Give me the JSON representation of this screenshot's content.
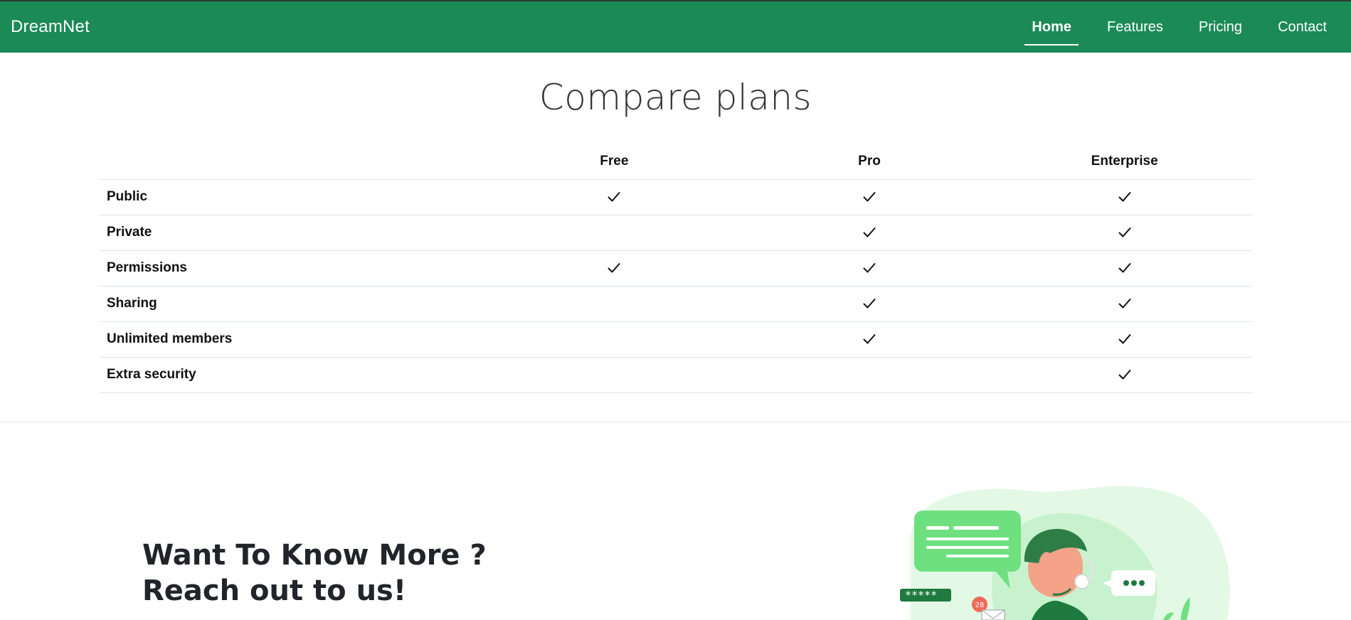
{
  "nav": {
    "brand": "DreamNet",
    "links": [
      {
        "label": "Home",
        "active": true
      },
      {
        "label": "Features",
        "active": false
      },
      {
        "label": "Pricing",
        "active": false
      },
      {
        "label": "Contact",
        "active": false
      }
    ]
  },
  "compare": {
    "title": "Compare plans",
    "plans": [
      "Free",
      "Pro",
      "Enterprise"
    ],
    "rows": [
      {
        "feature": "Public",
        "free": true,
        "pro": true,
        "enterprise": true
      },
      {
        "feature": "Private",
        "free": false,
        "pro": true,
        "enterprise": true
      },
      {
        "feature": "Permissions",
        "free": true,
        "pro": true,
        "enterprise": true
      },
      {
        "feature": "Sharing",
        "free": false,
        "pro": true,
        "enterprise": true
      },
      {
        "feature": "Unlimited members",
        "free": false,
        "pro": true,
        "enterprise": true
      },
      {
        "feature": "Extra security",
        "free": false,
        "pro": false,
        "enterprise": true
      }
    ]
  },
  "contact": {
    "heading_line1": "Want To Know More ?",
    "heading_line2": "Reach out to us!"
  },
  "illustration": {
    "password_mask": "*****",
    "notification_count": "28",
    "icon": "customer-support-illustration"
  },
  "colors": {
    "brand": "#1b8a57",
    "illustration_green": "#6fe07f",
    "illustration_bg": "#d9f7dc"
  }
}
